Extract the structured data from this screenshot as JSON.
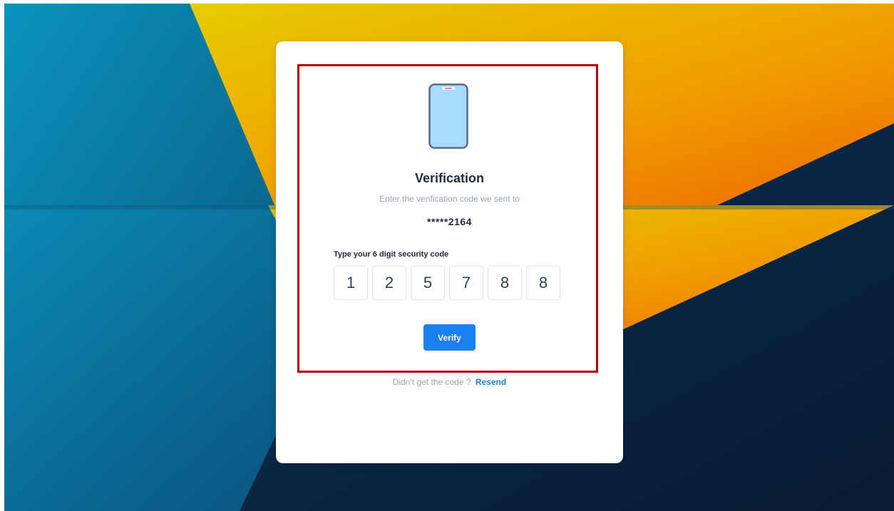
{
  "colors": {
    "accent": "#1a7ff0",
    "highlight_border": "#b30000",
    "phone_screen": "#a8dcfb",
    "phone_frame": "#5b6b82",
    "wallpaper_teal": "#0a7fa8",
    "wallpaper_navy": "#0b2544",
    "wallpaper_yellow": "#e6c800",
    "wallpaper_orange": "#ef7d00"
  },
  "icons": {
    "phone": "smartphone-icon"
  },
  "verification": {
    "title": "Verification",
    "subtitle": "Enter the verification code we sent to",
    "masked_number": "*****2164",
    "code_label": "Type your 6 digit security code",
    "code_digits": [
      "1",
      "2",
      "5",
      "7",
      "8",
      "8"
    ],
    "verify_label": "Verify",
    "resend_prompt": "Didn't get the code ?",
    "resend_link": "Resend"
  }
}
